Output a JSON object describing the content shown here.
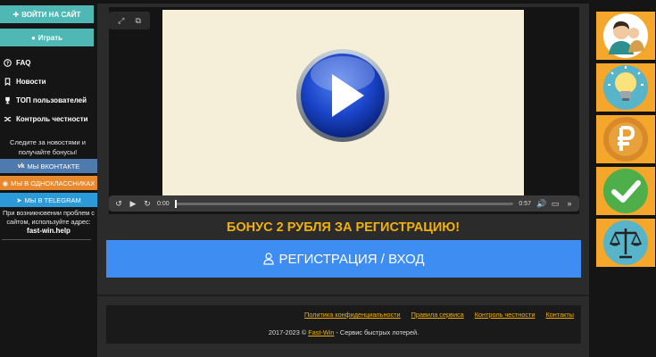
{
  "sidebar": {
    "login_label": "ВОЙТИ НА САЙТ",
    "play_label": "Играть",
    "menu": [
      {
        "label": "FAQ",
        "icon": "question-icon"
      },
      {
        "label": "Новости",
        "icon": "bookmark-icon"
      },
      {
        "label": "ТОП пользователей",
        "icon": "trophy-icon"
      },
      {
        "label": "Контроль честности",
        "icon": "shuffle-icon"
      }
    ],
    "follow_text": "Следите за новостями и получайте бонусы!",
    "social": {
      "vk": "МЫ ВКОНТАКТЕ",
      "ok": "МЫ В ОДНОКЛАССНИКАХ",
      "tg": "МЫ В TELEGRAM"
    },
    "problem_text": "При возникновении проблем с сайтом, используйте адрес:",
    "problem_link": "fast-win.help"
  },
  "player": {
    "time_current": "0:00",
    "time_total": "0:57",
    "progress": 0.0
  },
  "main": {
    "bonus_text": "БОНУС 2 РУБЛЯ ЗА РЕГИСТРАЦИЮ!",
    "register_label": "РЕГИСТРАЦИЯ / ВХОД"
  },
  "footer": {
    "links": [
      "Политика конфиденциальности",
      "Правила сервиса",
      "Контроль честности",
      "Контакты"
    ],
    "copyright_prefix": "2017-2023 ©",
    "brand": "Fast-Win",
    "copyright_suffix": "- Сервис быстрых лотерей."
  },
  "colors": {
    "accent_teal": "#4fb8b4",
    "bonus_yellow": "#f0b10e",
    "register_blue": "#3d8df2",
    "tile_orange": "#f4a72b"
  }
}
